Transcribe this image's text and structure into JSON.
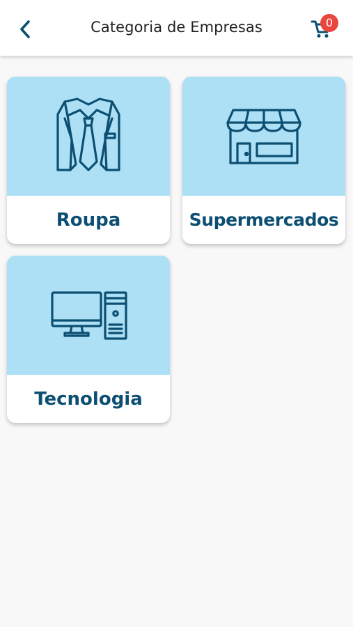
{
  "header": {
    "title": "Categoria de Empresas",
    "back_icon": "chevron-left-icon",
    "cart_icon": "shopping-cart-icon",
    "cart_count": "0"
  },
  "categories": [
    {
      "label": "Roupa",
      "icon": "shirt-tie-icon"
    },
    {
      "label": "Supermercados",
      "icon": "storefront-icon"
    },
    {
      "label": "Tecnologia",
      "icon": "desktop-computer-icon"
    }
  ],
  "colors": {
    "accent": "#0c4f72",
    "card_image_bg": "#aee0f5",
    "badge": "#e8473f",
    "background": "#f8f8f8"
  }
}
